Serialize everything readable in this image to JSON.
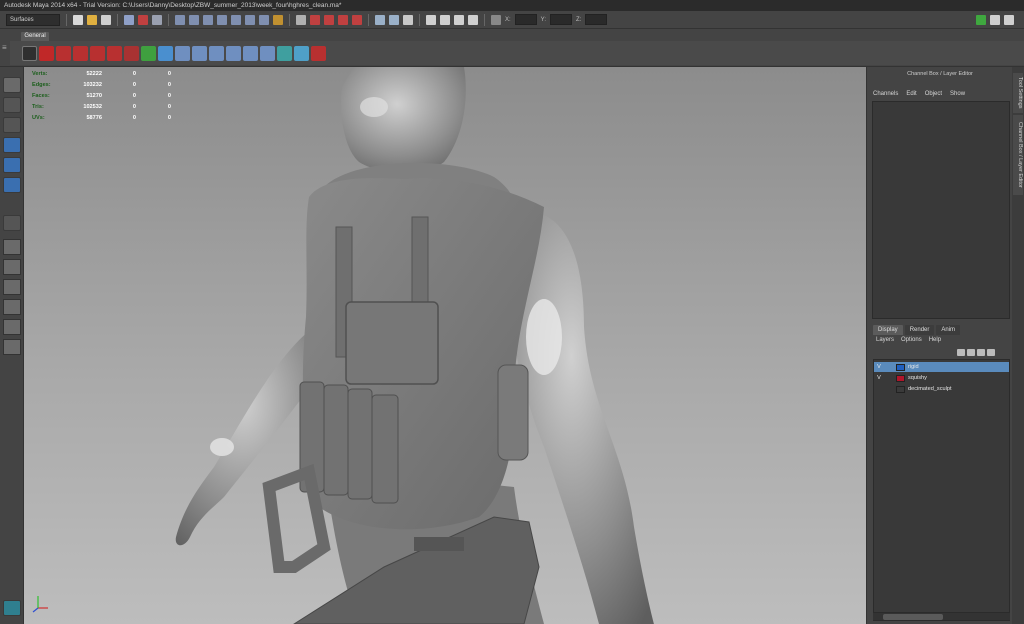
{
  "titlebar": {
    "title": "Autodesk Maya 2014 x64 - Trial Version: C:\\Users\\Danny\\Desktop\\ZBW_summer_2013\\week_four\\hghres_clean.ma*"
  },
  "statusline": {
    "menuset": "Surfaces",
    "axis_x": "X:",
    "axis_y": "Y:",
    "axis_z": "Z:"
  },
  "shelf": {
    "active_tab": "General"
  },
  "hud": {
    "rows": [
      {
        "label": "Verts:",
        "v1": "52222",
        "v2": "0",
        "v3": "0"
      },
      {
        "label": "Edges:",
        "v1": "103232",
        "v2": "0",
        "v3": "0"
      },
      {
        "label": "Faces:",
        "v1": "51270",
        "v2": "0",
        "v3": "0"
      },
      {
        "label": "Tris:",
        "v1": "102532",
        "v2": "0",
        "v3": "0"
      },
      {
        "label": "UVs:",
        "v1": "58776",
        "v2": "0",
        "v3": "0"
      }
    ]
  },
  "channel_box": {
    "header": "Channel Box / Layer Editor",
    "menu": [
      "Channels",
      "Edit",
      "Object",
      "Show"
    ]
  },
  "layer_editor": {
    "tabs": [
      "Display",
      "Render",
      "Anim"
    ],
    "menu": [
      "Layers",
      "Options",
      "Help"
    ],
    "layers": [
      {
        "vis": "V",
        "name": "rigid",
        "color": "#1f5fbf",
        "selected": true
      },
      {
        "vis": "V",
        "name": "squishy",
        "color": "#b0162a",
        "selected": false
      },
      {
        "vis": "",
        "name": "decimated_sculpt",
        "color": "#3a3a3a",
        "selected": false
      }
    ]
  },
  "side_tabs": [
    "Tool Settings",
    "Channel Box / Layer Editor"
  ]
}
